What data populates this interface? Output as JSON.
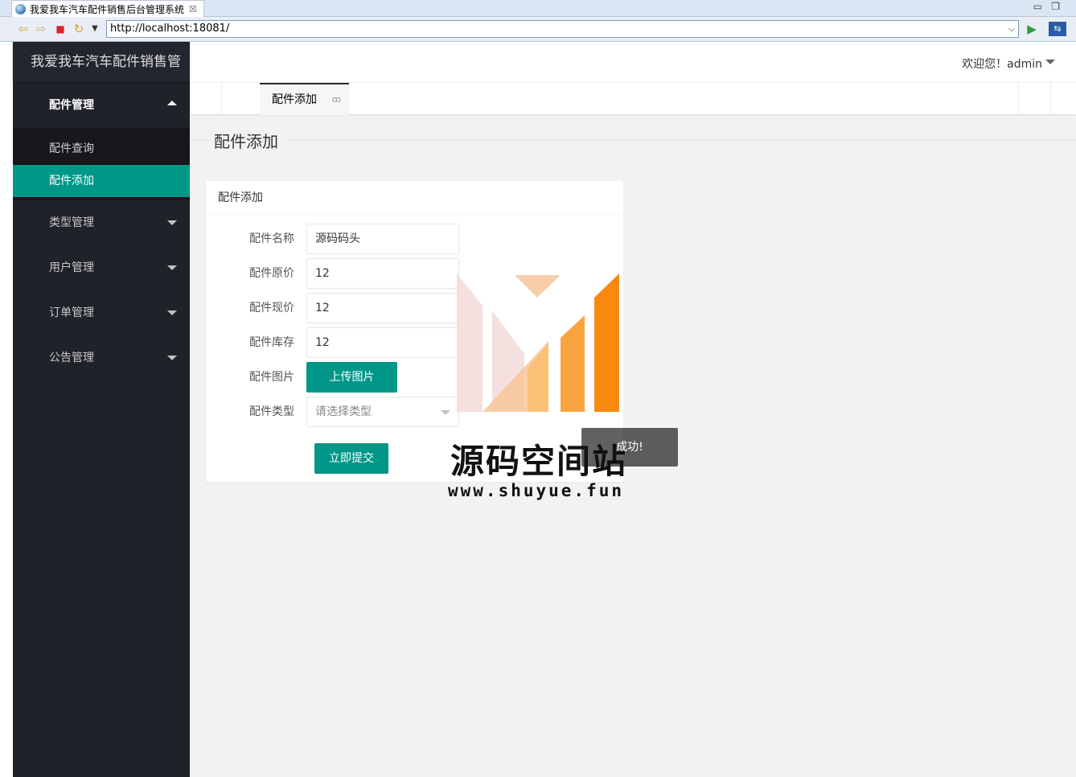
{
  "browser": {
    "tab_title": "我爱我车汽车配件销售后台管理系统",
    "tab_close": "☒",
    "url": "http://localhost:18081/"
  },
  "app": {
    "logo": "我爱我车汽车配件销售管",
    "welcome": "欢迎您！admin"
  },
  "sidebar": {
    "menus": [
      {
        "label": "配件管理",
        "open": true,
        "children": [
          "配件查询",
          "配件添加"
        ],
        "active_child": "配件添加"
      },
      {
        "label": "类型管理"
      },
      {
        "label": "用户管理"
      },
      {
        "label": "订单管理"
      },
      {
        "label": "公告管理"
      }
    ]
  },
  "tabs": {
    "active": "配件添加",
    "close_icon": "ꝏ"
  },
  "page": {
    "title": "配件添加"
  },
  "form": {
    "card_title": "配件添加",
    "fields": [
      {
        "label": "配件名称",
        "value": "源码码头"
      },
      {
        "label": "配件原价",
        "value": "12"
      },
      {
        "label": "配件现价",
        "value": "12"
      },
      {
        "label": "配件库存",
        "value": "12"
      }
    ],
    "image_label": "配件图片",
    "upload_button": "上传图片",
    "type_label": "配件类型",
    "type_placeholder": "请选择类型",
    "submit_button": "立即提交"
  },
  "toast": {
    "message": "成功!"
  },
  "watermark": {
    "title": "源码空间站",
    "url": "www.shuyue.fun"
  },
  "colors": {
    "accent": "#009688",
    "sidebar": "#20222a"
  }
}
